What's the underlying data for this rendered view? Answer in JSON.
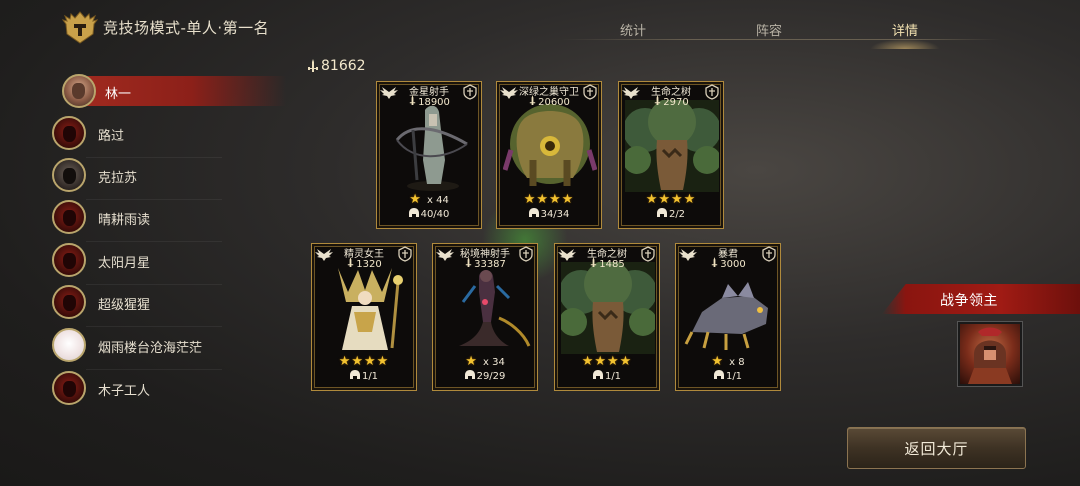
{
  "header": {
    "mode_title": "竞技场模式-单人·第一名",
    "mode_icon": "helmet-emblem-icon",
    "tabs": [
      {
        "label": "统计",
        "active": false
      },
      {
        "label": "阵容",
        "active": false
      },
      {
        "label": "详情",
        "active": true
      }
    ]
  },
  "players": [
    {
      "name": "林一",
      "active": true,
      "avatar": "human"
    },
    {
      "name": "路过",
      "active": false,
      "avatar": "demon"
    },
    {
      "name": "克拉苏",
      "active": false,
      "avatar": "dark"
    },
    {
      "name": "晴耕雨读",
      "active": false,
      "avatar": "demon"
    },
    {
      "name": "太阳月星",
      "active": false,
      "avatar": "demon"
    },
    {
      "name": "超级猩猩",
      "active": false,
      "avatar": "demon"
    },
    {
      "name": "烟雨楼台沧海茫茫",
      "active": false,
      "avatar": "light"
    },
    {
      "name": "木子工人",
      "active": false,
      "avatar": "demon"
    }
  ],
  "total_power": "81662",
  "heroes": [
    {
      "name": "金星射手",
      "power": "18900",
      "stars": 1,
      "star_mult": "x 44",
      "count": "40/40",
      "art": "archer"
    },
    {
      "name": "深绿之巢守卫",
      "power": "20600",
      "stars": 4,
      "star_mult": "",
      "count": "34/34",
      "art": "treant"
    },
    {
      "name": "生命之树",
      "power": "2970",
      "stars": 4,
      "star_mult": "",
      "count": "2/2",
      "art": "tree"
    },
    {
      "name": "精灵女王",
      "power": "1320",
      "stars": 4,
      "star_mult": "",
      "count": "1/1",
      "art": "queen"
    },
    {
      "name": "秘境神射手",
      "power": "33387",
      "stars": 1,
      "star_mult": "x 34",
      "count": "29/29",
      "art": "naga"
    },
    {
      "name": "生命之树",
      "power": "1485",
      "stars": 4,
      "star_mult": "",
      "count": "1/1",
      "art": "tree"
    },
    {
      "name": "暴君",
      "power": "3000",
      "stars": 1,
      "star_mult": "x 8",
      "count": "1/1",
      "art": "tyrant"
    }
  ],
  "war_lord": {
    "label": "战争领主",
    "portrait": "spartan-lord-portrait"
  },
  "back_button": "返回大厅",
  "colors": {
    "accent_red": "#a01b14",
    "gold": "#b08a3c",
    "star": "#f2c230"
  }
}
